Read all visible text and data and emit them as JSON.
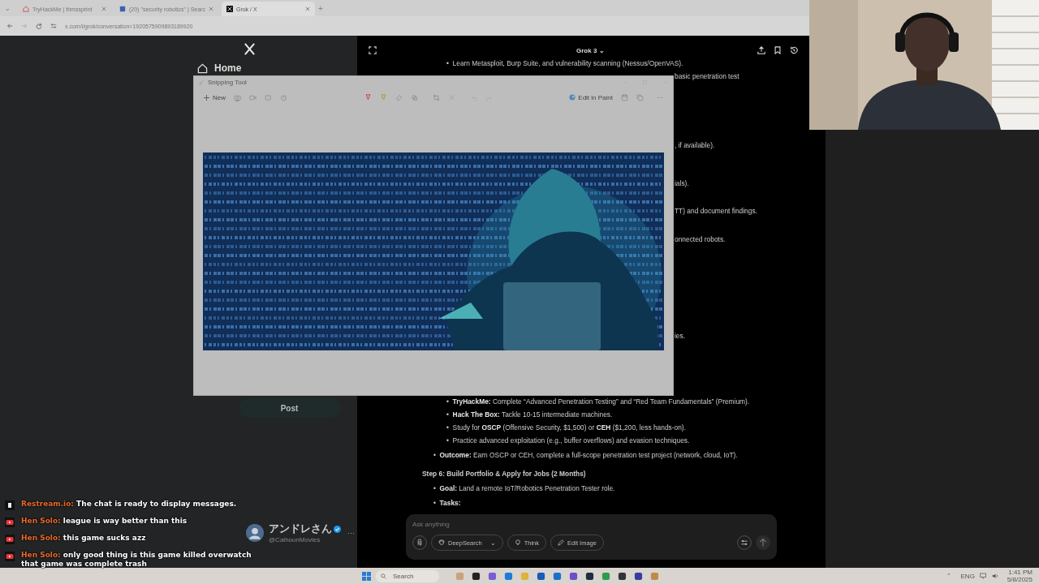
{
  "browser": {
    "tab_list": "⌄",
    "tabs": [
      {
        "title": "TryHackMe | thmssprint",
        "selected": false
      },
      {
        "title": "(20) \"security robotics\" | Searc",
        "selected": false
      },
      {
        "title": "Grok / X",
        "selected": true
      }
    ],
    "new_tab": "+",
    "url": "x.com/i/grok/conversation=1920575909893189920"
  },
  "x_sidebar": {
    "home": "Home",
    "post": "Post",
    "account": {
      "name": "アンドレさん",
      "handle": "@CalhounMovies",
      "verified": true,
      "more": "···"
    }
  },
  "grok": {
    "model": "Grok 3",
    "model_caret": "⌄",
    "content": [
      {
        "kind": "sub_bullet",
        "bullet": "•",
        "text": "Learn Metasploit, Burp Suite, and vulnerability scanning (Nessus/OpenVAS)."
      },
      {
        "kind": "fragments",
        "items": [
          "basic penetration test",
          ", if available).",
          "ials).",
          "TT) and document findings.",
          "onnected robots.",
          "ies."
        ]
      },
      {
        "kind": "sub_bullet",
        "bullet": "•",
        "text": "**TryHackMe:** Complete “Advanced Penetration Testing” and “Red Team Fundamentals” (Premium)."
      },
      {
        "kind": "sub_bullet",
        "bullet": "•",
        "text": "**Hack The Box:** Tackle 10-15 intermediate machines."
      },
      {
        "kind": "sub_bullet",
        "bullet": "•",
        "text": "Study for **OSCP** (Offensive Security, $1,500) or **CEH** ($1,200, less hands-on)."
      },
      {
        "kind": "sub_bullet",
        "bullet": "•",
        "text": "Practice advanced exploitation (e.g., buffer overflows) and evasion techniques."
      },
      {
        "kind": "bullet",
        "bullet": "•",
        "text": "**Outcome:** Earn OSCP or CEH, complete a full-scope penetration test project (network, cloud, IoT)."
      },
      {
        "kind": "heading",
        "text": "Step 6: Build Portfolio & Apply for Jobs (2 Months)"
      },
      {
        "kind": "bullet",
        "bullet": "•",
        "text": "**Goal:** Land a remote IoT/Robotics Penetration Tester role."
      },
      {
        "kind": "bullet",
        "bullet": "•",
        "text": "**Tasks:**"
      }
    ],
    "input": {
      "placeholder": "Ask anything",
      "tools": [
        {
          "label": "DeepSearch",
          "caret": "⌄"
        },
        {
          "label": "Think"
        },
        {
          "label": "Edit Image"
        }
      ]
    }
  },
  "snipping_tool": {
    "title": "Snipping Tool",
    "new": "New",
    "edit_in_paint": "Edit in Paint",
    "more": "···"
  },
  "chat": [
    {
      "kind": "restream",
      "user": "Restream.io:",
      "message": "The chat is ready to display messages."
    },
    {
      "kind": "youtube",
      "user": "Hen Solo:",
      "message": "league is way better than this"
    },
    {
      "kind": "youtube",
      "user": "Hen Solo:",
      "message": "this game sucks azz"
    },
    {
      "kind": "youtube",
      "user": "Hen Solo:",
      "message": "only good thing is this game killed overwatch that game was complete trash"
    }
  ],
  "taskbar": {
    "tray": "⌃",
    "search": "Search",
    "language": "ENG",
    "time": "1:41 PM",
    "date": "5/8/2025"
  }
}
